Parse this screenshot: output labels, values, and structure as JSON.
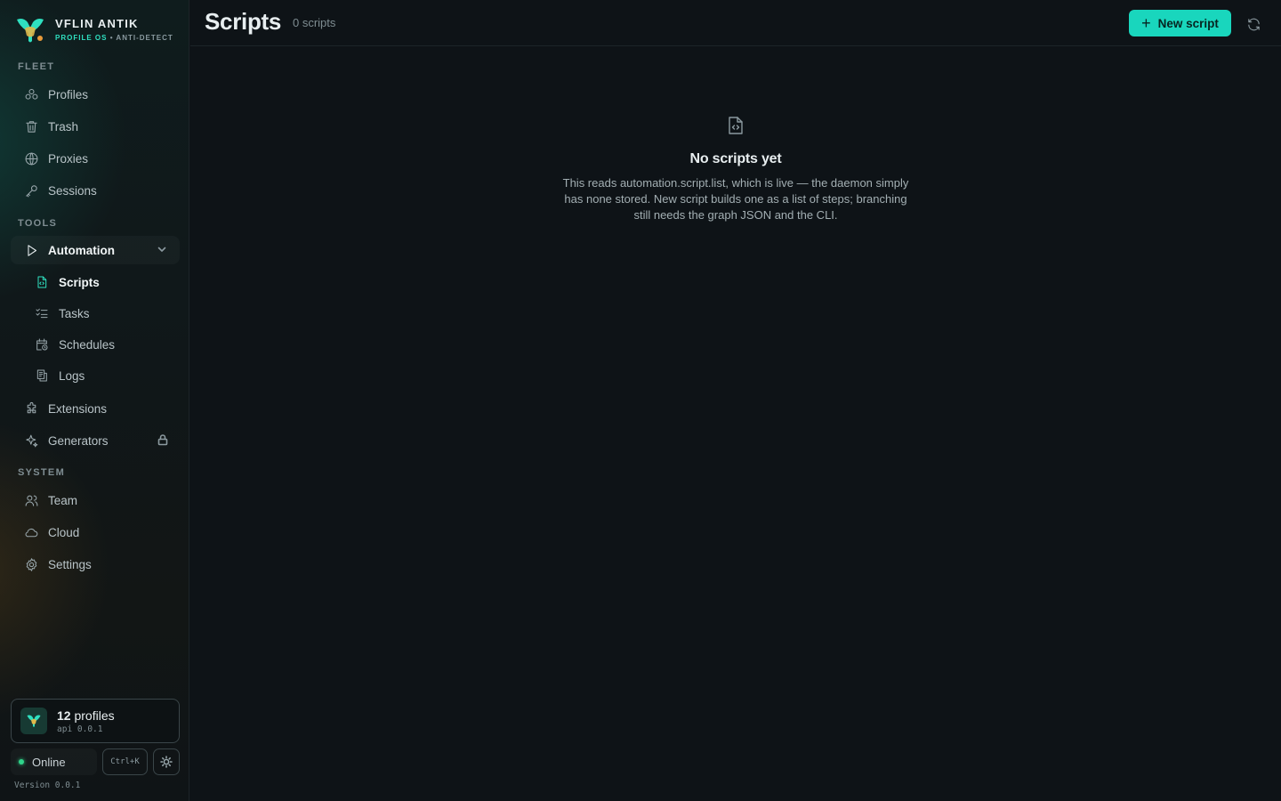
{
  "brand": {
    "name": "VFLIN ANTIK",
    "sub_accent": "PROFILE OS",
    "sub_rest": "• ANTI-DETECT",
    "accent_color": "#19d6bd"
  },
  "sidebar": {
    "sections": {
      "fleet": "FLEET",
      "tools": "TOOLS",
      "system": "SYSTEM"
    },
    "fleet_items": [
      {
        "label": "Profiles",
        "icon": "profiles-icon"
      },
      {
        "label": "Trash",
        "icon": "trash-icon"
      },
      {
        "label": "Proxies",
        "icon": "globe-icon"
      },
      {
        "label": "Sessions",
        "icon": "key-icon"
      }
    ],
    "automation": {
      "label": "Automation",
      "icon": "play-icon",
      "expanded": true,
      "children": [
        {
          "label": "Scripts",
          "icon": "file-code-icon",
          "active": true
        },
        {
          "label": "Tasks",
          "icon": "list-checks-icon"
        },
        {
          "label": "Schedules",
          "icon": "calendar-clock-icon"
        },
        {
          "label": "Logs",
          "icon": "logs-icon"
        }
      ]
    },
    "tools_items": [
      {
        "label": "Extensions",
        "icon": "puzzle-icon"
      },
      {
        "label": "Generators",
        "icon": "sparkles-icon",
        "locked": true
      }
    ],
    "system_items": [
      {
        "label": "Team",
        "icon": "users-icon"
      },
      {
        "label": "Cloud",
        "icon": "cloud-icon"
      },
      {
        "label": "Settings",
        "icon": "gear-icon"
      }
    ]
  },
  "footer": {
    "profiles_count": "12",
    "profiles_word": "profiles",
    "api": "api 0.0.1",
    "status": "Online",
    "shortcut": "Ctrl+K",
    "version": "Version 0.0.1"
  },
  "header": {
    "title": "Scripts",
    "count": "0 scripts",
    "new_button": "New script"
  },
  "empty_state": {
    "title": "No scripts yet",
    "description": "This reads automation.script.list, which is live — the daemon simply has none stored. New script builds one as a list of steps; branching still needs the graph JSON and the CLI."
  }
}
